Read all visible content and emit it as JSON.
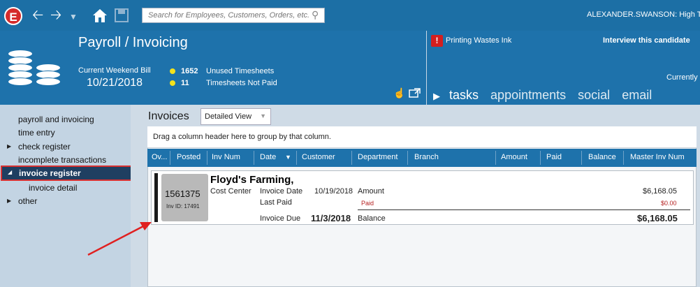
{
  "topbar": {
    "logo_letter": "E",
    "search_placeholder": "Search for Employees, Customers, Orders, etc.",
    "user": "ALEXANDER.SWANSON: High T"
  },
  "header": {
    "title": "Payroll / Invoicing",
    "current_weekend_label": "Current Weekend Bill",
    "current_weekend_date": "10/21/2018",
    "stats": [
      {
        "count": "1652",
        "label": "Unused Timesheets"
      },
      {
        "count": "11",
        "label": "Timesheets Not Paid"
      }
    ],
    "alert_text": "Printing Wastes Ink",
    "interview_text": "Interview this candidate",
    "currently_text": "Currently",
    "tabs": [
      "tasks",
      "appointments",
      "social",
      "email"
    ]
  },
  "leftnav": {
    "items": [
      "payroll and invoicing",
      "time entry",
      "check register",
      "incomplete transactions",
      "invoice register",
      "invoice detail",
      "other"
    ]
  },
  "main": {
    "title": "Invoices",
    "view": "Detailed View",
    "group_hint": "Drag a column header here to group by that column.",
    "columns": [
      "Ov...",
      "Posted",
      "Inv Num",
      "Date",
      "Customer",
      "Department",
      "Branch",
      "Amount",
      "Paid",
      "Balance",
      "Master Inv Num"
    ]
  },
  "record": {
    "inv_num": "1561375",
    "inv_id": "Inv ID: 17491",
    "customer": "Floyd's Farming,",
    "cost_center": "Cost Center",
    "invoice_date_label": "Invoice Date",
    "invoice_date": "10/19/2018",
    "last_paid_label": "Last Paid",
    "invoice_due_label": "Invoice Due",
    "invoice_due": "11/3/2018",
    "amount_label": "Amount",
    "amount": "$6,168.05",
    "paid_label": "Paid",
    "paid": "$0.00",
    "balance_label": "Balance",
    "balance": "$6,168.05"
  }
}
